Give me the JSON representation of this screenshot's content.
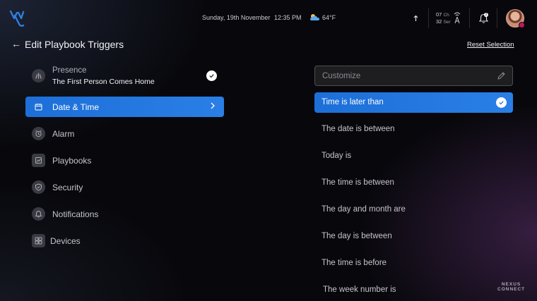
{
  "topbar": {
    "date": "Sunday, 19th November",
    "time": "12:35 PM",
    "temperature": "64°F",
    "channel_top_num": "07",
    "channel_top_label": "Ch",
    "channel_bottom_num": "32",
    "channel_bottom_label": "Ser",
    "notification_count": "2"
  },
  "header": {
    "title": "Edit Playbook Triggers",
    "reset_label": "Reset Selection"
  },
  "menu": {
    "presence_label": "Presence",
    "presence_value": "The First Person Comes Home",
    "items": [
      {
        "label": "Date & Time",
        "icon": "calendar-icon"
      },
      {
        "label": "Alarm",
        "icon": "alarm-clock-icon"
      },
      {
        "label": "Playbooks",
        "icon": "playbook-icon"
      },
      {
        "label": "Security",
        "icon": "shield-icon"
      },
      {
        "label": "Notifications",
        "icon": "notification-icon"
      },
      {
        "label": "Devices",
        "icon": "devices-icon"
      }
    ]
  },
  "right": {
    "customize_placeholder": "Customize",
    "options": [
      "Time is later than",
      "The date is between",
      "Today is",
      "The time is between",
      "The day and month are",
      "The day is between",
      "The time is before",
      "The week number is"
    ]
  },
  "brand": {
    "line1": "NEXUS",
    "line2": "CONNECT"
  },
  "colors": {
    "accent": "#1d6fd8",
    "background": "#08080c"
  }
}
